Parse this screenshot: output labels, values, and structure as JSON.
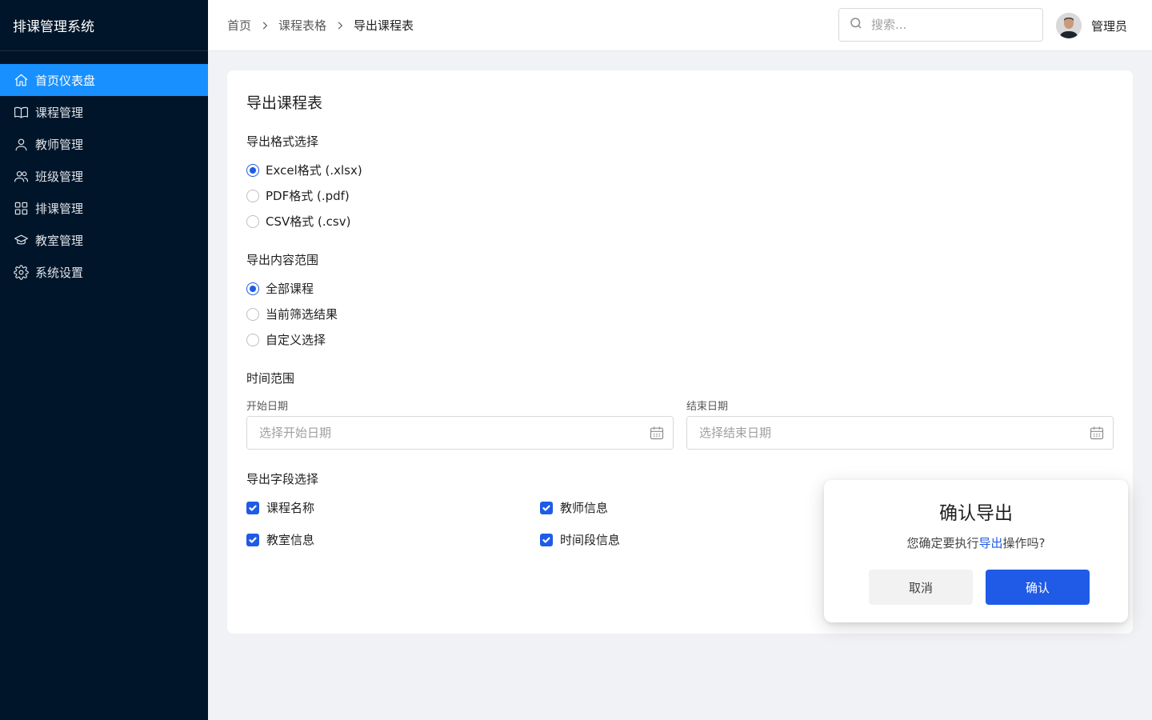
{
  "app": {
    "title": "排课管理系统"
  },
  "sidebar": {
    "items": [
      {
        "label": "首页仪表盘",
        "icon": "home-icon",
        "active": true
      },
      {
        "label": "课程管理",
        "icon": "book-icon"
      },
      {
        "label": "教师管理",
        "icon": "user-icon"
      },
      {
        "label": "班级管理",
        "icon": "users-icon"
      },
      {
        "label": "排课管理",
        "icon": "grid-icon"
      },
      {
        "label": "教室管理",
        "icon": "graduation-cap-icon"
      },
      {
        "label": "系统设置",
        "icon": "gear-icon"
      }
    ]
  },
  "header": {
    "breadcrumb": [
      "首页",
      "课程表格",
      "导出课程表"
    ],
    "search_placeholder": "搜索...",
    "user_name": "管理员"
  },
  "page": {
    "title": "导出课程表",
    "format": {
      "label": "导出格式选择",
      "options": [
        "Excel格式 (.xlsx)",
        "PDF格式 (.pdf)",
        "CSV格式 (.csv)"
      ],
      "selected": 0
    },
    "scope": {
      "label": "导出内容范围",
      "options": [
        "全部课程",
        "当前筛选结果",
        "自定义选择"
      ],
      "selected": 0
    },
    "time_range": {
      "label": "时间范围",
      "start_label": "开始日期",
      "start_placeholder": "选择开始日期",
      "end_label": "结束日期",
      "end_placeholder": "选择结束日期"
    },
    "fields": {
      "label": "导出字段选择",
      "items": [
        {
          "label": "课程名称",
          "checked": true
        },
        {
          "label": "教师信息",
          "checked": true
        },
        {
          "label": "教室信息",
          "checked": true
        },
        {
          "label": "时间段信息",
          "checked": true
        }
      ]
    }
  },
  "dialog": {
    "title": "确认导出",
    "message_prefix": "您确定要执行",
    "message_action": "导出",
    "message_suffix": "操作吗?",
    "cancel_label": "取消",
    "ok_label": "确认"
  },
  "colors": {
    "sidebar_bg": "#001529",
    "active": "#1890ff",
    "primary": "#1f5be6"
  }
}
